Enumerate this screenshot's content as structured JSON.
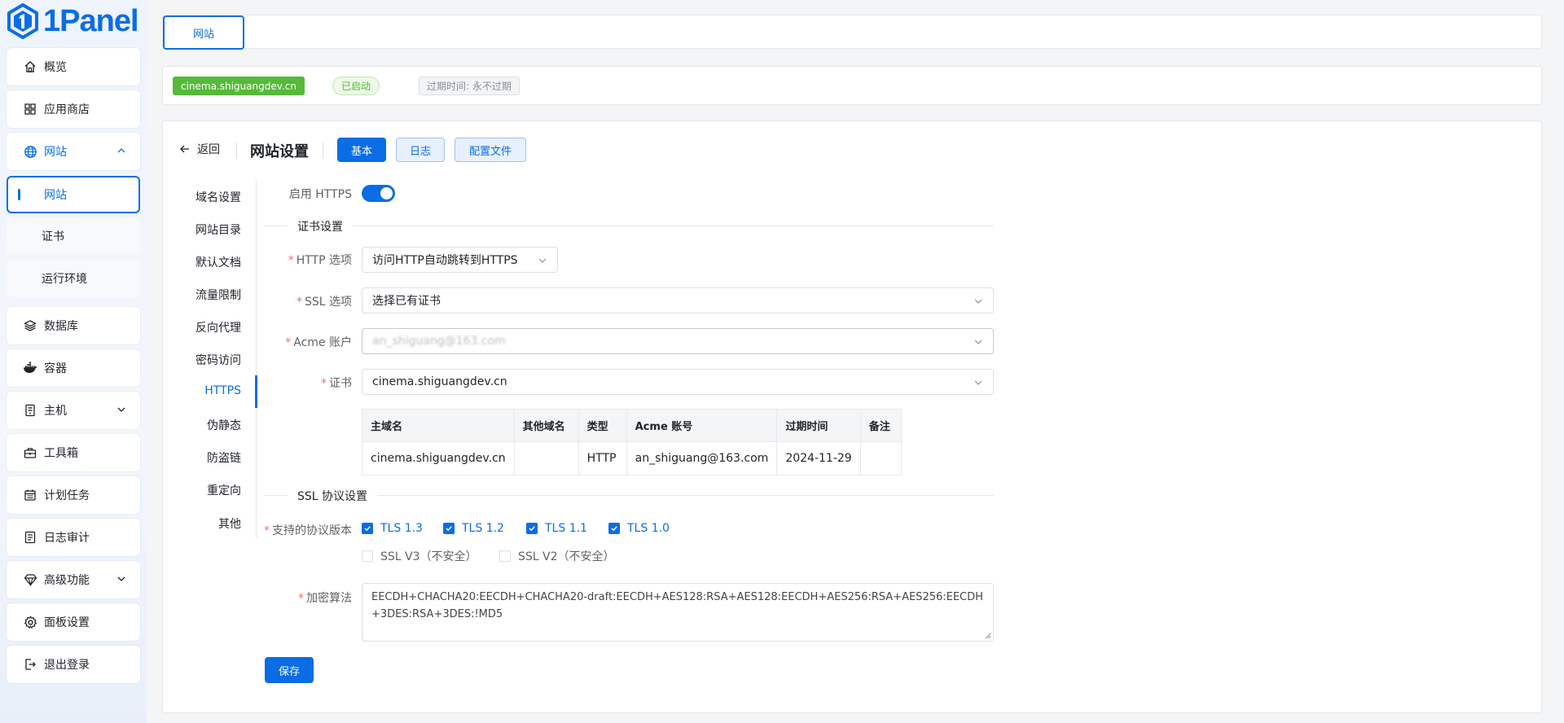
{
  "app": {
    "name": "1Panel"
  },
  "sidebar": {
    "items": [
      {
        "label": "概览",
        "icon": "home-icon"
      },
      {
        "label": "应用商店",
        "icon": "grid-icon"
      },
      {
        "label": "网站",
        "icon": "globe-icon"
      },
      {
        "label": "数据库",
        "icon": "layers-icon"
      },
      {
        "label": "容器",
        "icon": "docker-icon"
      },
      {
        "label": "主机",
        "icon": "server-icon"
      },
      {
        "label": "工具箱",
        "icon": "toolbox-icon"
      },
      {
        "label": "计划任务",
        "icon": "calendar-icon"
      },
      {
        "label": "日志审计",
        "icon": "log-icon"
      },
      {
        "label": "高级功能",
        "icon": "diamond-icon"
      },
      {
        "label": "面板设置",
        "icon": "gear-icon"
      },
      {
        "label": "退出登录",
        "icon": "logout-icon"
      }
    ],
    "sub_items": [
      {
        "label": "网站"
      },
      {
        "label": "证书"
      },
      {
        "label": "运行环境"
      }
    ],
    "active_item": "网站",
    "active_sub": "网站"
  },
  "tabs": {
    "site": "网站"
  },
  "status": {
    "domain": "cinema.shiguangdev.cn",
    "state": "已启动",
    "expire": "过期时间: 永不过期"
  },
  "header": {
    "back": "返回",
    "title": "网站设置",
    "buttons": {
      "basic": "基本",
      "log": "日志",
      "config": "配置文件"
    }
  },
  "left_menu": {
    "items": [
      "域名设置",
      "网站目录",
      "默认文档",
      "流量限制",
      "反向代理",
      "密码访问",
      "HTTPS",
      "伪静态",
      "防盗链",
      "重定向",
      "其他"
    ],
    "active": "HTTPS"
  },
  "form": {
    "https_label": "启用 HTTPS",
    "https_enabled": true,
    "cert_section": "证书设置",
    "http_option_label": "HTTP 选项",
    "http_option_value": "访问HTTP自动跳转到HTTPS",
    "ssl_option_label": "SSL 选项",
    "ssl_option_value": "选择已有证书",
    "acme_label": "Acme 账户",
    "acme_value": "an_shiguang@163.com",
    "cert_label": "证书",
    "cert_value": "cinema.shiguangdev.cn",
    "cert_table": {
      "headers": [
        "主域名",
        "其他域名",
        "类型",
        "Acme 账号",
        "过期时间",
        "备注"
      ],
      "rows": [
        [
          "cinema.shiguangdev.cn",
          "",
          "HTTP",
          "an_shiguang@163.com",
          "2024-11-29",
          ""
        ]
      ]
    },
    "ssl_section": "SSL 协议设置",
    "protocols_label": "支持的协议版本",
    "protocols": [
      {
        "label": "TLS 1.3",
        "checked": true
      },
      {
        "label": "TLS 1.2",
        "checked": true
      },
      {
        "label": "TLS 1.1",
        "checked": true
      },
      {
        "label": "TLS 1.0",
        "checked": true
      },
      {
        "label": "SSL V3（不安全）",
        "checked": false
      },
      {
        "label": "SSL V2（不安全）",
        "checked": false
      }
    ],
    "cipher_label": "加密算法",
    "cipher_value": "EECDH+CHACHA20:EECDH+CHACHA20-draft:EECDH+AES128:RSA+AES128:EECDH+AES256:RSA+AES256:EECDH+3DES:RSA+3DES:!MD5",
    "save": "保存"
  },
  "colors": {
    "primary": "#0b6de5",
    "success": "#55b93a",
    "danger": "#f56c6c"
  }
}
